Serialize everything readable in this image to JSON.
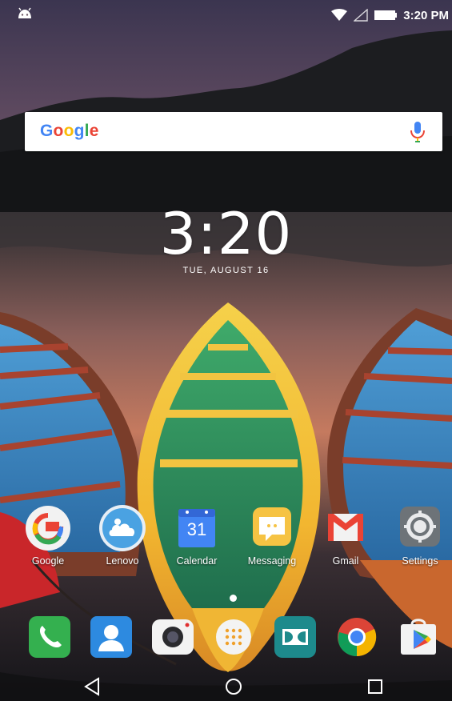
{
  "status_bar": {
    "notification_icon": "android-icon",
    "wifi_icon": "wifi-icon",
    "signal_icon": "cell-signal-icon",
    "battery_icon": "battery-icon",
    "time": "3:20 PM"
  },
  "search_widget": {
    "logo_text": "Google",
    "mic_icon": "mic-icon"
  },
  "clock_widget": {
    "time": "3:20",
    "date": "TUE, AUGUST 16"
  },
  "home_apps": [
    {
      "label": "Google",
      "icon": "google-icon"
    },
    {
      "label": "Lenovo",
      "icon": "lenovo-cloud-icon"
    },
    {
      "label": "Calendar",
      "icon": "calendar-icon",
      "badge": "31"
    },
    {
      "label": "Messaging",
      "icon": "messaging-icon"
    },
    {
      "label": "Gmail",
      "icon": "gmail-icon"
    },
    {
      "label": "Settings",
      "icon": "settings-gear-icon"
    }
  ],
  "dock": [
    {
      "icon": "phone-icon"
    },
    {
      "icon": "contacts-icon"
    },
    {
      "icon": "camera-icon"
    },
    {
      "icon": "app-drawer-icon"
    },
    {
      "icon": "dolby-icon"
    },
    {
      "icon": "chrome-icon"
    },
    {
      "icon": "play-store-icon"
    }
  ],
  "nav_bar": {
    "back": "back-icon",
    "home": "home-icon",
    "recents": "recents-icon"
  },
  "colors": {
    "google_blue": "#4285F4",
    "google_red": "#EA4335",
    "google_yellow": "#FBBC05",
    "google_green": "#34A853"
  }
}
